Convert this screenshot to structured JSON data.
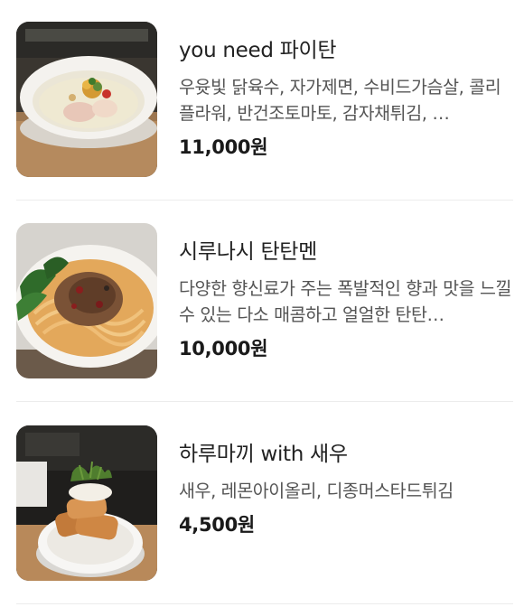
{
  "menu": {
    "items": [
      {
        "name": "you need 파이탄",
        "description": "우윳빛 닭육수, 자가제면, 수비드가슴살, 콜리플라워, 반건조토마토, 감자채튀김, …",
        "price": "11,000원",
        "image_icon": "paitan-ramen-bowl-photo"
      },
      {
        "name": "시루나시 탄탄멘",
        "description": "다양한 향신료가 주는 폭발적인 향과 맛을 느낄 수 있는 다소 매콤하고 얼얼한 탄탄…",
        "price": "10,000원",
        "image_icon": "tantanmen-bowl-photo"
      },
      {
        "name": "하루마끼 with 새우",
        "description": "새우, 레몬아이올리, 디종머스타드튀김",
        "price": "4,500원",
        "image_icon": "harumaki-shrimp-plate-photo"
      }
    ]
  }
}
